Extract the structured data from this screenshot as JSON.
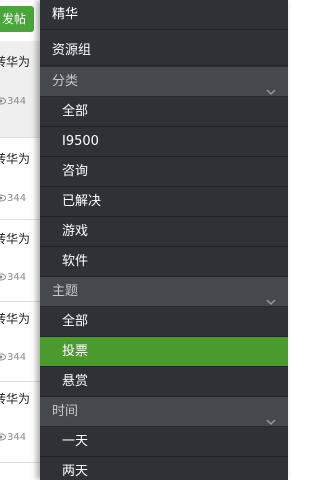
{
  "behind": {
    "post_button": "发帖",
    "rows": [
      {
        "title": "转华为",
        "views": "344"
      },
      {
        "title": "转华为",
        "views": "344"
      },
      {
        "title": "转华为",
        "views": "344"
      },
      {
        "title": "转华为",
        "views": "344"
      },
      {
        "title": "转华为",
        "views": "344"
      }
    ]
  },
  "drawer": {
    "top_items": [
      "精华",
      "资源组"
    ],
    "sections": [
      {
        "title": "分类",
        "items": [
          "全部",
          "I9500",
          "咨询",
          "已解决",
          "游戏",
          "软件"
        ]
      },
      {
        "title": "主题",
        "items": [
          "全部",
          "投票",
          "悬赏"
        ],
        "selected_index": 1
      },
      {
        "title": "时间",
        "items": [
          "一天",
          "两天"
        ]
      }
    ]
  },
  "colors": {
    "drawer_bg": "#2f3136",
    "section_bg": "#45484d",
    "selected": "#4a9a2e",
    "post_button": "#4aa63a"
  }
}
